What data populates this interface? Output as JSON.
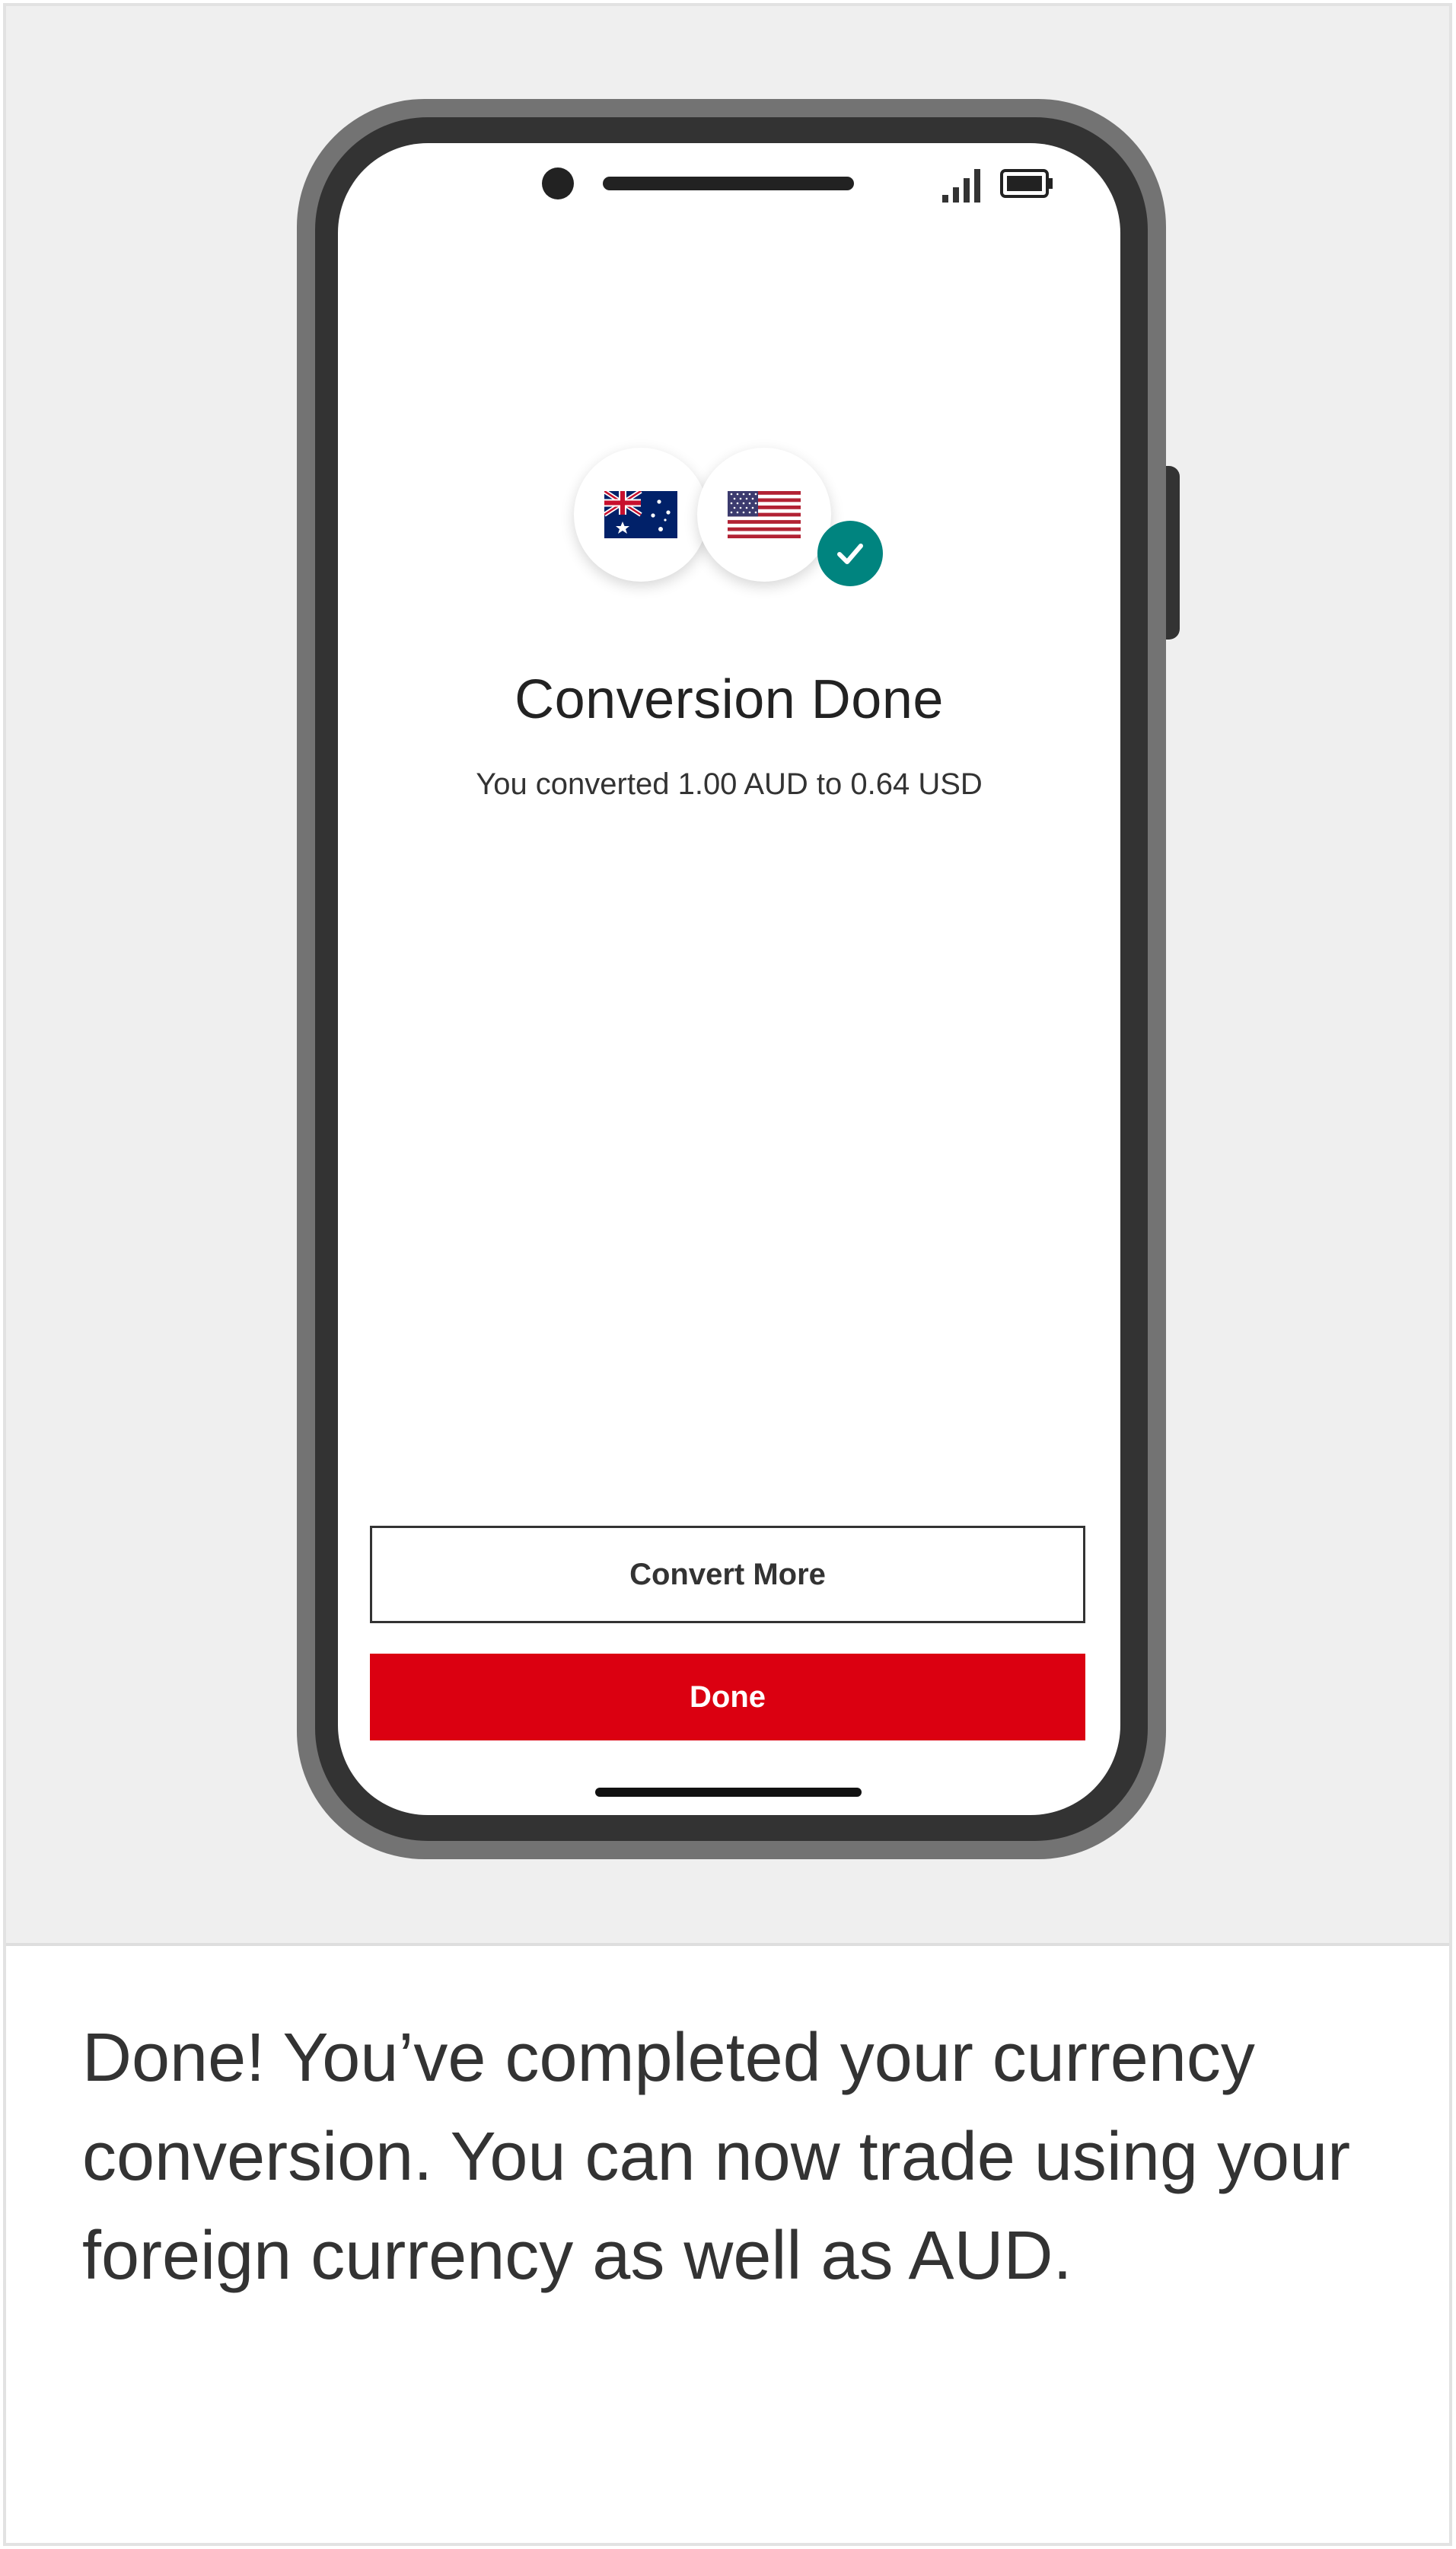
{
  "screen": {
    "status_icons": [
      "signal-icon",
      "battery-icon"
    ],
    "flags": [
      {
        "name": "australia-flag-icon",
        "currency": "AUD"
      },
      {
        "name": "united-states-flag-icon",
        "currency": "USD"
      }
    ],
    "success_icon": "check-icon",
    "title": "Conversion Done",
    "subtitle": "You converted 1.00 AUD to 0.64 USD",
    "buttons": {
      "convert_more": "Convert More",
      "done": "Done"
    }
  },
  "caption": "Done! You’ve completed your currency conversion. You can now trade using your foreign currency as well as AUD.",
  "colors": {
    "primary_red": "#db0011",
    "success_teal": "#00847f",
    "background": "#efefef",
    "phone_frame": "#333333"
  }
}
